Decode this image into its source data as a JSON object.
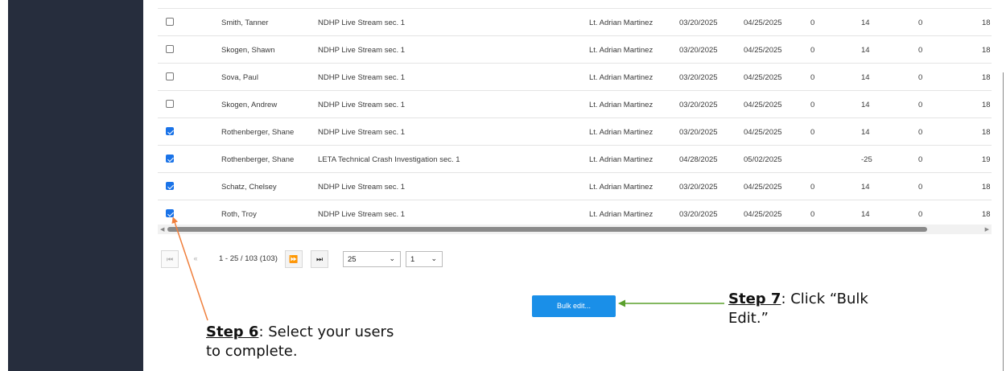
{
  "table": {
    "rows": [
      {
        "checked": false,
        "name": "Smith, Tanner",
        "course": "NDHP Live Stream sec. 1",
        "instructor": "Lt. Adrian Martinez",
        "start": "03/20/2025",
        "end": "04/25/2025",
        "a": "0",
        "b": "14",
        "c": "0",
        "d": "18"
      },
      {
        "checked": false,
        "name": "Skogen, Shawn",
        "course": "NDHP Live Stream sec. 1",
        "instructor": "Lt. Adrian Martinez",
        "start": "03/20/2025",
        "end": "04/25/2025",
        "a": "0",
        "b": "14",
        "c": "0",
        "d": "18"
      },
      {
        "checked": false,
        "name": "Sova, Paul",
        "course": "NDHP Live Stream sec. 1",
        "instructor": "Lt. Adrian Martinez",
        "start": "03/20/2025",
        "end": "04/25/2025",
        "a": "0",
        "b": "14",
        "c": "0",
        "d": "18"
      },
      {
        "checked": false,
        "name": "Skogen, Andrew",
        "course": "NDHP Live Stream sec. 1",
        "instructor": "Lt. Adrian Martinez",
        "start": "03/20/2025",
        "end": "04/25/2025",
        "a": "0",
        "b": "14",
        "c": "0",
        "d": "18"
      },
      {
        "checked": true,
        "name": "Rothenberger, Shane",
        "course": "NDHP Live Stream sec. 1",
        "instructor": "Lt. Adrian Martinez",
        "start": "03/20/2025",
        "end": "04/25/2025",
        "a": "0",
        "b": "14",
        "c": "0",
        "d": "18"
      },
      {
        "checked": true,
        "name": "Rothenberger, Shane",
        "course": "LETA Technical Crash Investigation sec. 1",
        "instructor": "Lt. Adrian Martinez",
        "start": "04/28/2025",
        "end": "05/02/2025",
        "a": "",
        "b": "-25",
        "c": "0",
        "d": "19"
      },
      {
        "checked": true,
        "name": "Schatz, Chelsey",
        "course": "NDHP Live Stream sec. 1",
        "instructor": "Lt. Adrian Martinez",
        "start": "03/20/2025",
        "end": "04/25/2025",
        "a": "0",
        "b": "14",
        "c": "0",
        "d": "18"
      },
      {
        "checked": true,
        "name": "Roth, Troy",
        "course": "NDHP Live Stream sec. 1",
        "instructor": "Lt. Adrian Martinez",
        "start": "03/20/2025",
        "end": "04/25/2025",
        "a": "0",
        "b": "14",
        "c": "0",
        "d": "18"
      }
    ]
  },
  "pager": {
    "range_text": "1 - 25 / 103 (103)",
    "page_size": "25",
    "page": "1"
  },
  "actions": {
    "bulk_edit_label": "Bulk edit..."
  },
  "annotations": {
    "step6_label": "Step 6",
    "step6_text": ": Select your users to complete.",
    "step7_label": "Step 7",
    "step7_text": ": Click “Bulk Edit.”",
    "step6_arrow_color": "#f07f3c",
    "step7_arrow_color": "#5aa02c"
  },
  "colors": {
    "sidebar": "#262d3d",
    "accent": "#1a8fe8",
    "checkbox_checked": "#1a73e8"
  }
}
